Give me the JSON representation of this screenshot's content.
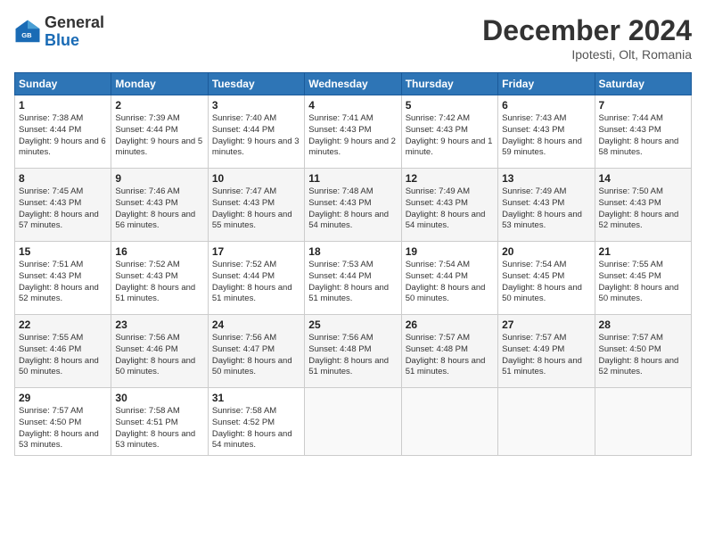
{
  "header": {
    "logo_general": "General",
    "logo_blue": "Blue",
    "month_title": "December 2024",
    "location": "Ipotesti, Olt, Romania"
  },
  "days_of_week": [
    "Sunday",
    "Monday",
    "Tuesday",
    "Wednesday",
    "Thursday",
    "Friday",
    "Saturday"
  ],
  "weeks": [
    [
      {
        "day": "1",
        "sunrise": "7:38 AM",
        "sunset": "4:44 PM",
        "daylight": "9 hours and 6 minutes."
      },
      {
        "day": "2",
        "sunrise": "7:39 AM",
        "sunset": "4:44 PM",
        "daylight": "9 hours and 5 minutes."
      },
      {
        "day": "3",
        "sunrise": "7:40 AM",
        "sunset": "4:44 PM",
        "daylight": "9 hours and 3 minutes."
      },
      {
        "day": "4",
        "sunrise": "7:41 AM",
        "sunset": "4:43 PM",
        "daylight": "9 hours and 2 minutes."
      },
      {
        "day": "5",
        "sunrise": "7:42 AM",
        "sunset": "4:43 PM",
        "daylight": "9 hours and 1 minute."
      },
      {
        "day": "6",
        "sunrise": "7:43 AM",
        "sunset": "4:43 PM",
        "daylight": "8 hours and 59 minutes."
      },
      {
        "day": "7",
        "sunrise": "7:44 AM",
        "sunset": "4:43 PM",
        "daylight": "8 hours and 58 minutes."
      }
    ],
    [
      {
        "day": "8",
        "sunrise": "7:45 AM",
        "sunset": "4:43 PM",
        "daylight": "8 hours and 57 minutes."
      },
      {
        "day": "9",
        "sunrise": "7:46 AM",
        "sunset": "4:43 PM",
        "daylight": "8 hours and 56 minutes."
      },
      {
        "day": "10",
        "sunrise": "7:47 AM",
        "sunset": "4:43 PM",
        "daylight": "8 hours and 55 minutes."
      },
      {
        "day": "11",
        "sunrise": "7:48 AM",
        "sunset": "4:43 PM",
        "daylight": "8 hours and 54 minutes."
      },
      {
        "day": "12",
        "sunrise": "7:49 AM",
        "sunset": "4:43 PM",
        "daylight": "8 hours and 54 minutes."
      },
      {
        "day": "13",
        "sunrise": "7:49 AM",
        "sunset": "4:43 PM",
        "daylight": "8 hours and 53 minutes."
      },
      {
        "day": "14",
        "sunrise": "7:50 AM",
        "sunset": "4:43 PM",
        "daylight": "8 hours and 52 minutes."
      }
    ],
    [
      {
        "day": "15",
        "sunrise": "7:51 AM",
        "sunset": "4:43 PM",
        "daylight": "8 hours and 52 minutes."
      },
      {
        "day": "16",
        "sunrise": "7:52 AM",
        "sunset": "4:43 PM",
        "daylight": "8 hours and 51 minutes."
      },
      {
        "day": "17",
        "sunrise": "7:52 AM",
        "sunset": "4:44 PM",
        "daylight": "8 hours and 51 minutes."
      },
      {
        "day": "18",
        "sunrise": "7:53 AM",
        "sunset": "4:44 PM",
        "daylight": "8 hours and 51 minutes."
      },
      {
        "day": "19",
        "sunrise": "7:54 AM",
        "sunset": "4:44 PM",
        "daylight": "8 hours and 50 minutes."
      },
      {
        "day": "20",
        "sunrise": "7:54 AM",
        "sunset": "4:45 PM",
        "daylight": "8 hours and 50 minutes."
      },
      {
        "day": "21",
        "sunrise": "7:55 AM",
        "sunset": "4:45 PM",
        "daylight": "8 hours and 50 minutes."
      }
    ],
    [
      {
        "day": "22",
        "sunrise": "7:55 AM",
        "sunset": "4:46 PM",
        "daylight": "8 hours and 50 minutes."
      },
      {
        "day": "23",
        "sunrise": "7:56 AM",
        "sunset": "4:46 PM",
        "daylight": "8 hours and 50 minutes."
      },
      {
        "day": "24",
        "sunrise": "7:56 AM",
        "sunset": "4:47 PM",
        "daylight": "8 hours and 50 minutes."
      },
      {
        "day": "25",
        "sunrise": "7:56 AM",
        "sunset": "4:48 PM",
        "daylight": "8 hours and 51 minutes."
      },
      {
        "day": "26",
        "sunrise": "7:57 AM",
        "sunset": "4:48 PM",
        "daylight": "8 hours and 51 minutes."
      },
      {
        "day": "27",
        "sunrise": "7:57 AM",
        "sunset": "4:49 PM",
        "daylight": "8 hours and 51 minutes."
      },
      {
        "day": "28",
        "sunrise": "7:57 AM",
        "sunset": "4:50 PM",
        "daylight": "8 hours and 52 minutes."
      }
    ],
    [
      {
        "day": "29",
        "sunrise": "7:57 AM",
        "sunset": "4:50 PM",
        "daylight": "8 hours and 53 minutes."
      },
      {
        "day": "30",
        "sunrise": "7:58 AM",
        "sunset": "4:51 PM",
        "daylight": "8 hours and 53 minutes."
      },
      {
        "day": "31",
        "sunrise": "7:58 AM",
        "sunset": "4:52 PM",
        "daylight": "8 hours and 54 minutes."
      },
      null,
      null,
      null,
      null
    ]
  ]
}
